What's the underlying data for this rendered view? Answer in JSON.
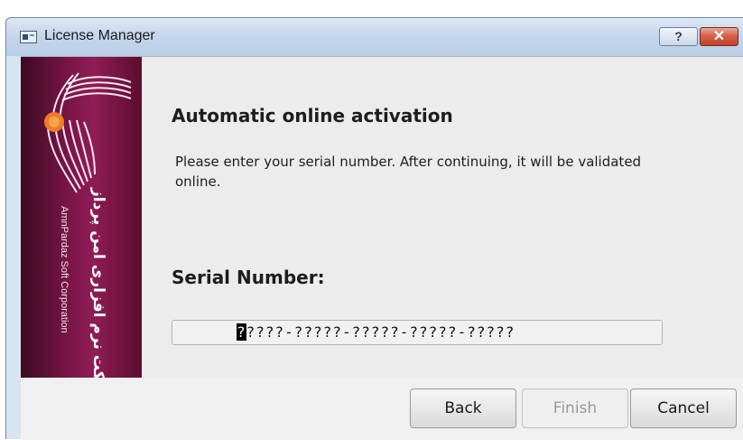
{
  "window": {
    "title": "License Manager",
    "help_label": "?",
    "close_label": "✕"
  },
  "branding": {
    "company_en": "AmnPardaz Soft Corporation",
    "company_fa": "شرکت نرم افزاری امن پرداز"
  },
  "page": {
    "heading": "Automatic online activation",
    "description": "Please enter your serial number. After continuing, it will be validated online.",
    "serial_label": "Serial Number:",
    "serial_cursor_char": "?",
    "serial_value_rest": "????-?????-?????-?????-?????"
  },
  "buttons": {
    "back": "Back",
    "finish": "Finish",
    "cancel": "Cancel"
  },
  "colors": {
    "brand_panel": "#7a1548",
    "logo_accent": "#f07a2a",
    "close_button": "#d8624a"
  },
  "icons": {
    "app": "app-window-icon",
    "logo": "company-logo"
  }
}
